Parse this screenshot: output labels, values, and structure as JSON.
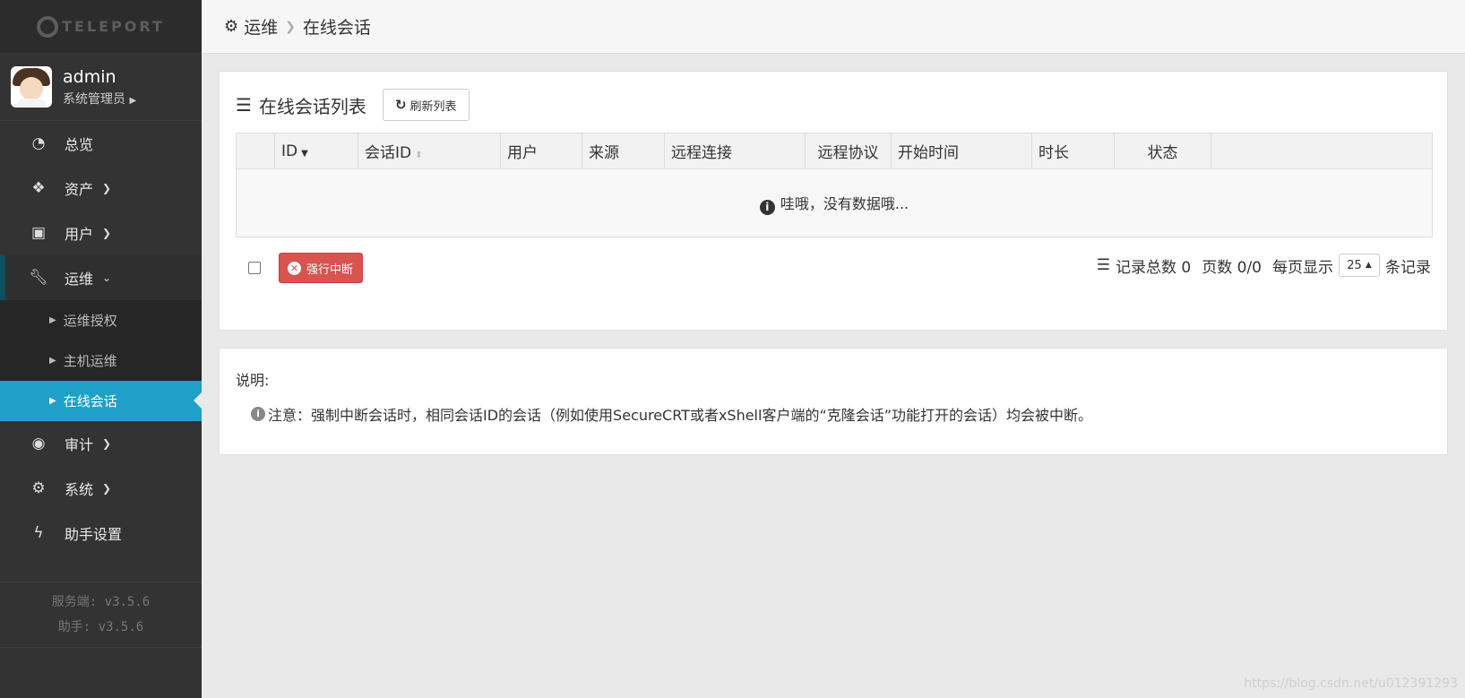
{
  "logo": {
    "text": "TELEPORT"
  },
  "user": {
    "name": "admin",
    "role": "系统管理员"
  },
  "nav": [
    {
      "label": "总览",
      "icon": "dashboard-icon"
    },
    {
      "label": "资产",
      "icon": "cubes-icon"
    },
    {
      "label": "用户",
      "icon": "address-book-icon"
    },
    {
      "label": "运维",
      "icon": "wrench-icon"
    },
    {
      "label": "审计",
      "icon": "eye-icon"
    },
    {
      "label": "系统",
      "icon": "gear-icon"
    },
    {
      "label": "助手设置",
      "icon": "bolt-icon"
    }
  ],
  "submenu": [
    {
      "label": "运维授权"
    },
    {
      "label": "主机运维"
    },
    {
      "label": "在线会话"
    }
  ],
  "versions": {
    "server": "服务端: v3.5.6",
    "assist": "助手: v3.5.6"
  },
  "breadcrumb": {
    "parent": "运维",
    "current": "在线会话"
  },
  "list": {
    "title": "在线会话列表",
    "refresh_label": "刷新列表",
    "columns": [
      "ID",
      "会话ID",
      "用户",
      "来源",
      "远程连接",
      "远程协议",
      "开始时间",
      "时长",
      "状态"
    ],
    "empty_message": "哇哦，没有数据哦...",
    "kill_label": "强行中断",
    "total_label": "记录总数 0",
    "pages_label": "页数 0/0",
    "per_page_label": "每页显示",
    "page_size": "25",
    "records_suffix": "条记录"
  },
  "note": {
    "title": "说明:",
    "text": "注意：强制中断会话时，相同会话ID的会话（例如使用SecureCRT或者xShell客户端的“克隆会话”功能打开的会话）均会被中断。"
  },
  "watermark": "https://blog.csdn.net/u012391293",
  "colors": {
    "accent": "#1ea0c8",
    "danger": "#d9534f",
    "sidebar": "#333333"
  }
}
